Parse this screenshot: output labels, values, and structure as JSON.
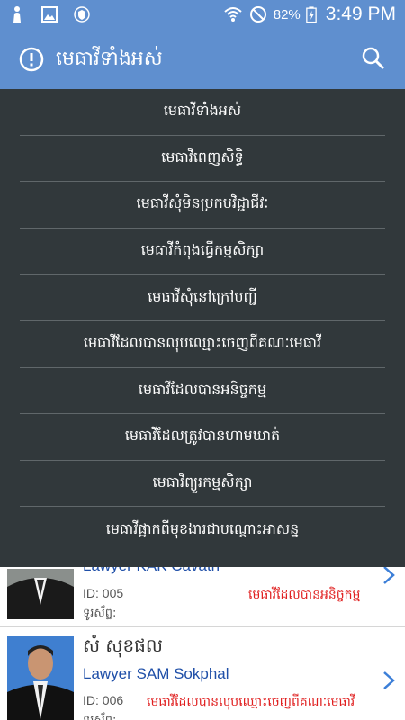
{
  "status_bar": {
    "battery_percent": "82%",
    "time": "3:49 PM",
    "icons": [
      "notification-icon",
      "gallery-icon",
      "shield-icon",
      "wifi-icon",
      "do-not-disturb-icon",
      "battery-charging-icon"
    ]
  },
  "app_bar": {
    "title": "មេធាវីទាំងអស់",
    "icons": [
      "info-icon",
      "search-icon"
    ]
  },
  "menu": {
    "items": [
      {
        "label": "មេធាវីទាំងអស់"
      },
      {
        "label": "មេធាវីពេញសិទ្ធិ"
      },
      {
        "label": "មេធាវីសុំមិនប្រកបវិជ្ជាជីវៈ"
      },
      {
        "label": "មេធាវីកំពុងធ្វើកម្មសិក្សា"
      },
      {
        "label": "មេធាវីសុំនៅក្រៅបញ្ជី"
      },
      {
        "label": "មេធាវីដែលបានលុបឈ្មោះចេញពីគណៈមេធាវី"
      },
      {
        "label": "មេធាវីដែលបានអនិច្ចកម្ម"
      },
      {
        "label": "មេធាវីដែលត្រូវបានហាមឃាត់"
      },
      {
        "label": "មេធាវីព្យួរកម្មសិក្សា"
      },
      {
        "label": "មេធាវីផ្អាកពីមុខងារជាបណ្ដោះអាសន្ន"
      }
    ]
  },
  "lawyers": [
    {
      "name_en": "Lawyer KAK Cavath",
      "id": "ID: 005",
      "status": "មេធាវីដែលបានអនិច្ចកម្ម",
      "phone_label": "ទូរស័ព្ទ:"
    },
    {
      "name_kh": "សំ សុខផល",
      "name_en": "Lawyer SAM Sokphal",
      "id": "ID: 006",
      "status": "មេធាវីដែលបានលុបឈ្មោះចេញពីគណៈមេធាវី",
      "phone_label": "ទូរស័ព្ទ:"
    }
  ],
  "colors": {
    "app_bar": "#5f8fcf",
    "menu_background": "#31383b",
    "status_text": "#e02020",
    "name_en_text": "#1f4fa8"
  }
}
